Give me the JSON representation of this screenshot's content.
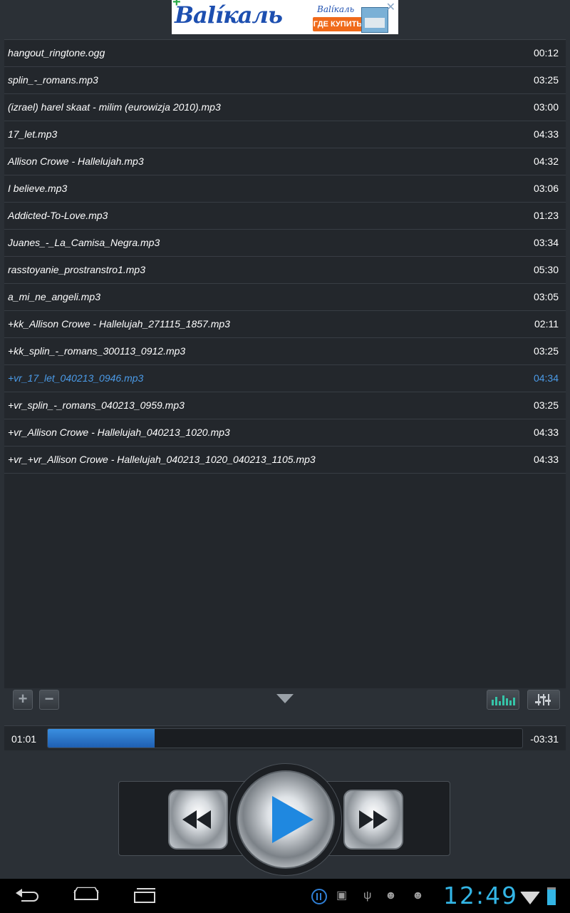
{
  "ad": {
    "logo_text": "Вalíкаль",
    "small_logo": "Вalíкаль",
    "button_label": "ГДЕ КУПИТЬ",
    "close": "✕"
  },
  "playlist": {
    "tracks": [
      {
        "name": "hangout_ringtone.ogg",
        "duration": "00:12"
      },
      {
        "name": "splin_-_romans.mp3",
        "duration": "03:25"
      },
      {
        "name": "(izrael) harel skaat - milim (eurowizja 2010).mp3",
        "duration": "03:00"
      },
      {
        "name": "17_let.mp3",
        "duration": "04:33"
      },
      {
        "name": "Allison Crowe - Hallelujah.mp3",
        "duration": "04:32"
      },
      {
        "name": "I believe.mp3",
        "duration": "03:06"
      },
      {
        "name": "Addicted-To-Love.mp3",
        "duration": "01:23"
      },
      {
        "name": "Juanes_-_La_Camisa_Negra.mp3",
        "duration": "03:34"
      },
      {
        "name": "rasstoyanie_prostranstro1.mp3",
        "duration": "05:30"
      },
      {
        "name": "a_mi_ne_angeli.mp3",
        "duration": "03:05"
      },
      {
        "name": "+kk_Allison Crowe - Hallelujah_271115_1857.mp3",
        "duration": "02:11"
      },
      {
        "name": "+kk_splin_-_romans_300113_0912.mp3",
        "duration": "03:25"
      },
      {
        "name": "+vr_17_let_040213_0946.mp3",
        "duration": "04:34"
      },
      {
        "name": "+vr_splin_-_romans_040213_0959.mp3",
        "duration": "03:25"
      },
      {
        "name": "+vr_Allison Crowe - Hallelujah_040213_1020.mp3",
        "duration": "04:33"
      },
      {
        "name": "+vr_+vr_Allison Crowe - Hallelujah_040213_1020_040213_1105.mp3",
        "duration": "04:33"
      }
    ],
    "active_index": 12,
    "active_color": "#4b9be8"
  },
  "toolbar": {
    "add_icon": "+",
    "remove_icon": "−"
  },
  "player": {
    "elapsed": "01:01",
    "remaining": "-03:31",
    "progress_fraction": 0.225
  },
  "status": {
    "clock": "12:49"
  }
}
